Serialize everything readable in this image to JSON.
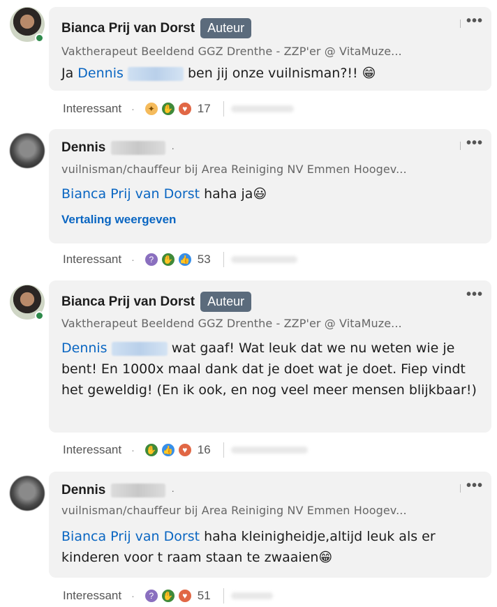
{
  "comments": [
    {
      "author": "Bianca Prij van Dorst",
      "badge": "Auteur",
      "headline": "Vaktherapeut Beeldend GGZ Drenthe - ZZP'er @ VitaMuze...",
      "mention": "Dennis",
      "text": "ben jij onze vuilnisman?!! 😁",
      "action_label": "Interessant",
      "reaction_count": "17"
    },
    {
      "author": "Dennis",
      "headline": "vuilnisman/chauffeur bij Area Reiniging NV Emmen Hoogev...",
      "mention": "Bianca Prij van Dorst",
      "text": "haha ja😃",
      "translate": "Vertaling weergeven",
      "action_label": "Interessant",
      "reaction_count": "53"
    },
    {
      "author": "Bianca Prij van Dorst",
      "badge": "Auteur",
      "headline": "Vaktherapeut Beeldend GGZ Drenthe - ZZP'er @ VitaMuze...",
      "mention": "Dennis",
      "text": "wat gaaf! Wat leuk dat we nu weten wie je bent! En 1000x maal dank dat je doet wat je doet. Fiep vindt het geweldig! (En ik ook, en nog veel meer mensen blijkbaar!)",
      "action_label": "Interessant",
      "reaction_count": "16"
    },
    {
      "author": "Dennis",
      "headline": "vuilnisman/chauffeur bij Area Reiniging NV Emmen Hoogev...",
      "mention": "Bianca Prij van Dorst",
      "text": "haha kleinigheidje,altijd leuk als er kinderen voor t raam staan te zwaaien😁",
      "action_label": "Interessant",
      "reaction_count": "51"
    }
  ],
  "more_icon": "•••",
  "separator": "·",
  "icons": {
    "insight": "lightbulb-icon",
    "celebrate": "celebrate-icon",
    "love": "heart-icon",
    "like": "thumbs-up-icon",
    "curious": "curious-icon",
    "more": "more-icon"
  },
  "colors": {
    "link": "#0a66c2",
    "badge": "#5b6b7c",
    "bubble": "#f2f2f2"
  }
}
